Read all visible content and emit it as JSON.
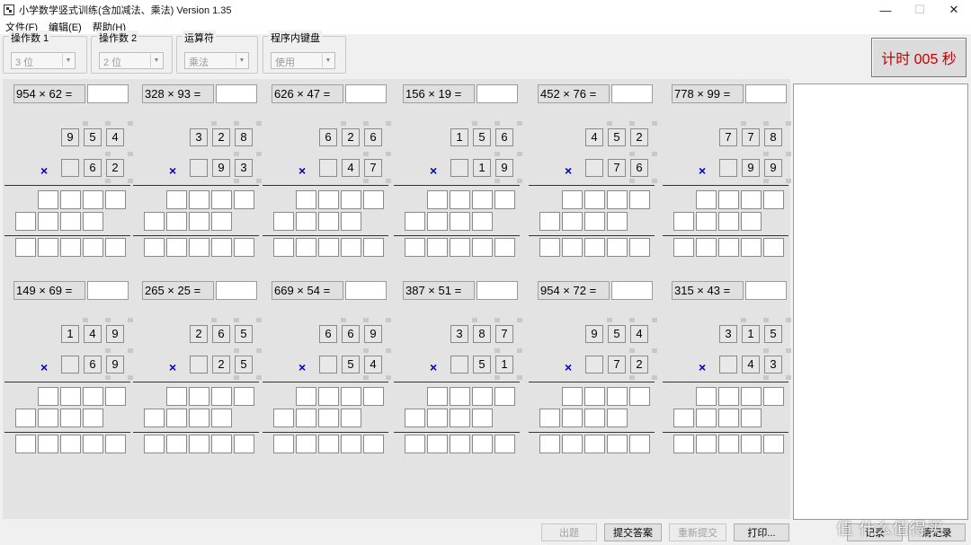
{
  "window": {
    "title": "小学数学竖式训练(含加减法、乘法) Version 1.35",
    "minimize": "—",
    "maximize": "☐",
    "close": "✕"
  },
  "menu": [
    "文件(F)",
    "编辑(E)",
    "帮助(H)"
  ],
  "settings": [
    {
      "label": "操作数 1",
      "value": "3 位"
    },
    {
      "label": "操作数 2",
      "value": "2 位"
    },
    {
      "label": "运算符",
      "value": "乘法"
    },
    {
      "label": "程序内键盘",
      "value": "使用"
    }
  ],
  "timer": "计时   005 秒",
  "operator_symbol": "×",
  "problems": [
    {
      "equation": "954 × 62 =",
      "top": [
        "9",
        "5",
        "4"
      ],
      "bottom": [
        "",
        "6",
        "2"
      ]
    },
    {
      "equation": "328 × 93 =",
      "top": [
        "3",
        "2",
        "8"
      ],
      "bottom": [
        "",
        "9",
        "3"
      ]
    },
    {
      "equation": "626 × 47 =",
      "top": [
        "6",
        "2",
        "6"
      ],
      "bottom": [
        "",
        "4",
        "7"
      ]
    },
    {
      "equation": "156 × 19 =",
      "top": [
        "1",
        "5",
        "6"
      ],
      "bottom": [
        "",
        "1",
        "9"
      ]
    },
    {
      "equation": "452 × 76 =",
      "top": [
        "4",
        "5",
        "2"
      ],
      "bottom": [
        "",
        "7",
        "6"
      ]
    },
    {
      "equation": "778 × 99 =",
      "top": [
        "7",
        "7",
        "8"
      ],
      "bottom": [
        "",
        "9",
        "9"
      ]
    },
    {
      "equation": "149 × 69 =",
      "top": [
        "1",
        "4",
        "9"
      ],
      "bottom": [
        "",
        "6",
        "9"
      ]
    },
    {
      "equation": "265 × 25 =",
      "top": [
        "2",
        "6",
        "5"
      ],
      "bottom": [
        "",
        "2",
        "5"
      ]
    },
    {
      "equation": "669 × 54 =",
      "top": [
        "6",
        "6",
        "9"
      ],
      "bottom": [
        "",
        "5",
        "4"
      ]
    },
    {
      "equation": "387 × 51 =",
      "top": [
        "3",
        "8",
        "7"
      ],
      "bottom": [
        "",
        "5",
        "1"
      ]
    },
    {
      "equation": "954 × 72 =",
      "top": [
        "9",
        "5",
        "4"
      ],
      "bottom": [
        "",
        "7",
        "2"
      ]
    },
    {
      "equation": "315 × 43 =",
      "top": [
        "3",
        "1",
        "5"
      ],
      "bottom": [
        "",
        "4",
        "3"
      ]
    }
  ],
  "buttons": {
    "generate": "出题",
    "submit": "提交答案",
    "resubmit": "重新提交",
    "print": "打印...",
    "records": "记录",
    "clear_records": "清记录"
  },
  "watermark": "值 什么值得买"
}
